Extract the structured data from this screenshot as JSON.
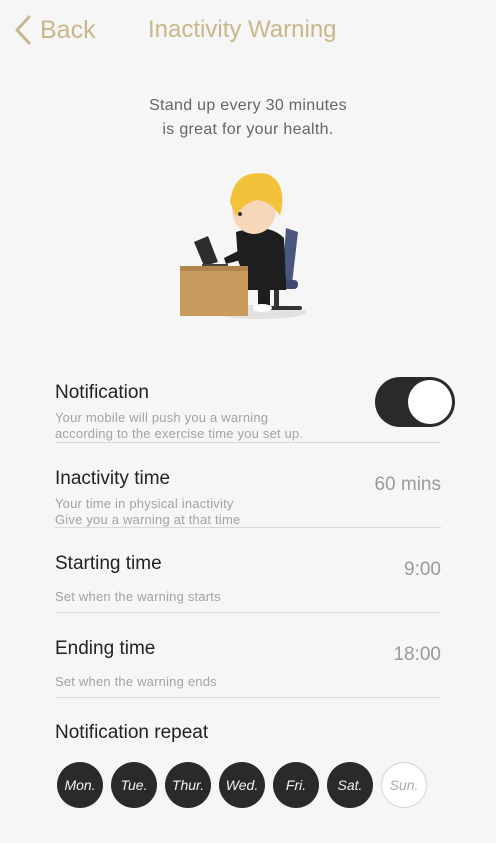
{
  "header": {
    "back_label": "Back",
    "title": "Inactivity Warning"
  },
  "intro": {
    "line1": "Stand up every 30 minutes",
    "line2": "is great for your health."
  },
  "notification": {
    "title": "Notification",
    "desc1": "Your mobile will push you a warning",
    "desc2": "according to the exercise time you set up.",
    "enabled": true
  },
  "inactivity": {
    "title": "Inactivity time",
    "desc1": "Your time in physical inactivity",
    "desc2": "Give you a warning at that time",
    "value": "60 mins"
  },
  "starting": {
    "title": "Starting time",
    "desc": "Set when the warning starts",
    "value": "9:00"
  },
  "ending": {
    "title": "Ending time",
    "desc": "Set when the warning ends",
    "value": "18:00"
  },
  "repeat": {
    "title": "Notification repeat",
    "days": [
      {
        "label": "Mon.",
        "selected": true
      },
      {
        "label": "Tue.",
        "selected": true
      },
      {
        "label": "Thur.",
        "selected": true
      },
      {
        "label": "Wed.",
        "selected": true
      },
      {
        "label": "Fri.",
        "selected": true
      },
      {
        "label": "Sat.",
        "selected": true
      },
      {
        "label": "Sun.",
        "selected": false
      }
    ]
  },
  "colors": {
    "accent": "#c7b78a",
    "dark": "#2a2a2a",
    "background": "#f6f6f6"
  }
}
